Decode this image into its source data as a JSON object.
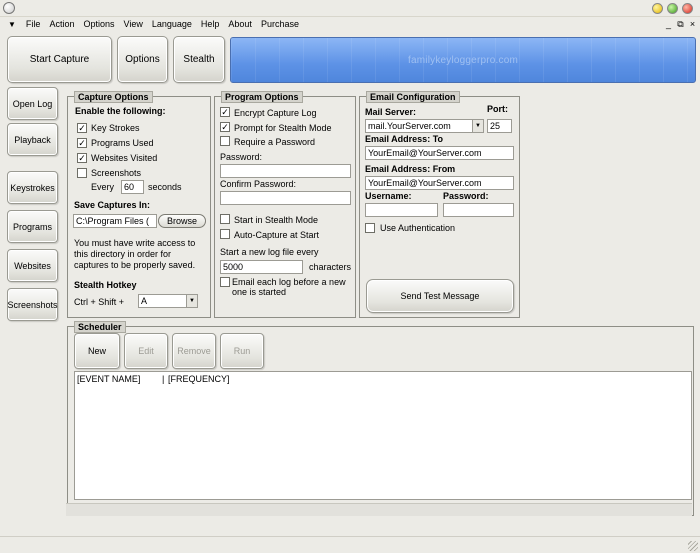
{
  "menubar": {
    "system_glyph": "▼",
    "items": [
      "File",
      "Action",
      "Options",
      "View",
      "Language",
      "Help",
      "About",
      "Purchase"
    ],
    "mdi_controls": [
      "_",
      "⧉",
      "×"
    ]
  },
  "toolbar": {
    "start_capture": "Start Capture",
    "options": "Options",
    "stealth": "Stealth",
    "banner_text": "familykeyloggerpro.com"
  },
  "sidebar": {
    "open_log": "Open Log",
    "playback": "Playback",
    "keystrokes": "Keystrokes",
    "programs": "Programs",
    "websites": "Websites",
    "screenshots": "Screenshots"
  },
  "capture_options": {
    "title": "Capture Options",
    "enable_label": "Enable the following:",
    "key_strokes": {
      "label": "Key Strokes",
      "checked": true
    },
    "programs_used": {
      "label": "Programs Used",
      "checked": true
    },
    "websites_visited": {
      "label": "Websites Visited",
      "checked": true
    },
    "screenshots": {
      "label": "Screenshots",
      "checked": false
    },
    "every_label": "Every",
    "every_value": "60",
    "seconds_label": "seconds",
    "save_label": "Save Captures In:",
    "path_value": "C:\\Program Files (",
    "browse": "Browse",
    "note_line1": "You must have write access to",
    "note_line2": "this directory in order for",
    "note_line3": "captures to be properly saved.",
    "hotkey_label": "Stealth Hotkey",
    "hotkey_prefix": "Ctrl + Shift +",
    "hotkey_value": "A"
  },
  "program_options": {
    "title": "Program Options",
    "encrypt_log": {
      "label": "Encrypt Capture Log",
      "checked": true
    },
    "prompt_stealth": {
      "label": "Prompt for Stealth Mode",
      "checked": true
    },
    "require_password": {
      "label": "Require a Password",
      "checked": false
    },
    "password_label": "Password:",
    "password_value": "",
    "confirm_label": "Confirm Password:",
    "confirm_value": "",
    "start_stealth": {
      "label": "Start in Stealth Mode",
      "checked": false
    },
    "auto_capture": {
      "label": "Auto-Capture at Start",
      "checked": false
    },
    "new_log_label": "Start a new log file every",
    "new_log_value": "5000",
    "characters_label": "characters",
    "email_each_line1": "Email each log before a new",
    "email_each_line2": "one is started",
    "email_each_checked": false
  },
  "email_config": {
    "title": "Email Configuration",
    "server_label": "Mail Server:",
    "server_value": "mail.YourServer.com",
    "port_label": "Port:",
    "port_value": "25",
    "to_label": "Email Address: To",
    "to_value": "YourEmail@YourServer.com",
    "from_label": "Email Address: From",
    "from_value": "YourEmail@YourServer.com",
    "username_label": "Username:",
    "username_value": "",
    "password_label": "Password:",
    "password_value": "",
    "use_auth": {
      "label": "Use Authentication",
      "checked": false
    },
    "send_test": "Send Test Message"
  },
  "scheduler": {
    "title": "Scheduler",
    "new": "New",
    "edit": "Edit",
    "remove": "Remove",
    "run": "Run",
    "col_event": "[EVENT NAME]",
    "col_sep": "|",
    "col_frequency": "[FREQUENCY]"
  }
}
